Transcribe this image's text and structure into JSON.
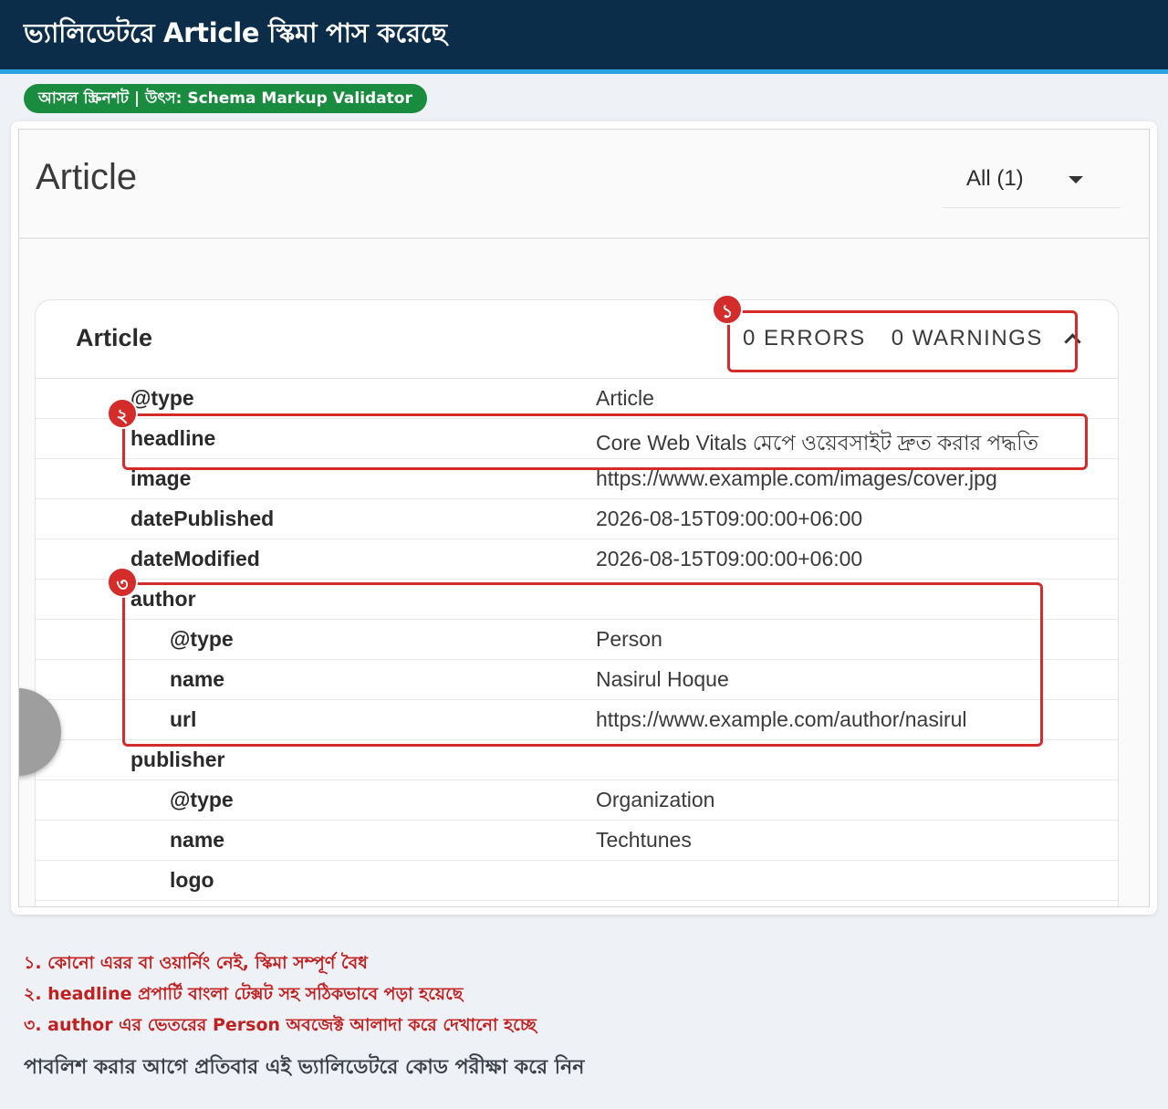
{
  "header": {
    "title": "ভ্যালিডেটরে Article স্কিমা পাস করেছে"
  },
  "source_badge": "আসল স্ক্রিনশট | উৎস: Schema Markup Validator",
  "validator": {
    "page_title": "Article",
    "filter": {
      "label": "All (1)"
    },
    "card": {
      "title": "Article",
      "errors": "0 ERRORS",
      "warnings": "0 WARNINGS",
      "rows": [
        {
          "key": "@type",
          "value": "Article"
        },
        {
          "key": "headline",
          "value": "Core Web Vitals মেপে ওয়েবসাইট দ্রুত করার পদ্ধতি"
        },
        {
          "key": "image",
          "value": "https://www.example.com/images/cover.jpg"
        },
        {
          "key": "datePublished",
          "value": "2026-08-15T09:00:00+06:00"
        },
        {
          "key": "dateModified",
          "value": "2026-08-15T09:00:00+06:00"
        },
        {
          "key": "author",
          "value": ""
        },
        {
          "key": "@type",
          "value": "Person"
        },
        {
          "key": "name",
          "value": "Nasirul Hoque"
        },
        {
          "key": "url",
          "value": "https://www.example.com/author/nasirul"
        },
        {
          "key": "publisher",
          "value": ""
        },
        {
          "key": "@type",
          "value": "Organization"
        },
        {
          "key": "name",
          "value": "Techtunes"
        },
        {
          "key": "logo",
          "value": ""
        }
      ]
    }
  },
  "annotations": {
    "badges": [
      "১",
      "২",
      "৩"
    ],
    "color": "#d42b2b"
  },
  "notes": [
    "১. কোনো এরর বা ওয়ার্নিং নেই, স্কিমা সম্পূর্ণ বৈধ",
    "২. headline প্রপার্টি বাংলা টেক্সট সহ সঠিকভাবে পড়া হয়েছে",
    "৩. author এর ভেতরের Person অবজেক্ট আলাদা করে দেখানো হচ্ছে"
  ],
  "footer": "পাবলিশ করার আগে প্রতিবার এই ভ্যালিডেটরে কোড পরীক্ষা করে নিন",
  "colors": {
    "topbar": "#0b2d4a",
    "accent": "#2aa3e0",
    "pill": "#1a8c3f",
    "annotation": "#d42b2b"
  }
}
